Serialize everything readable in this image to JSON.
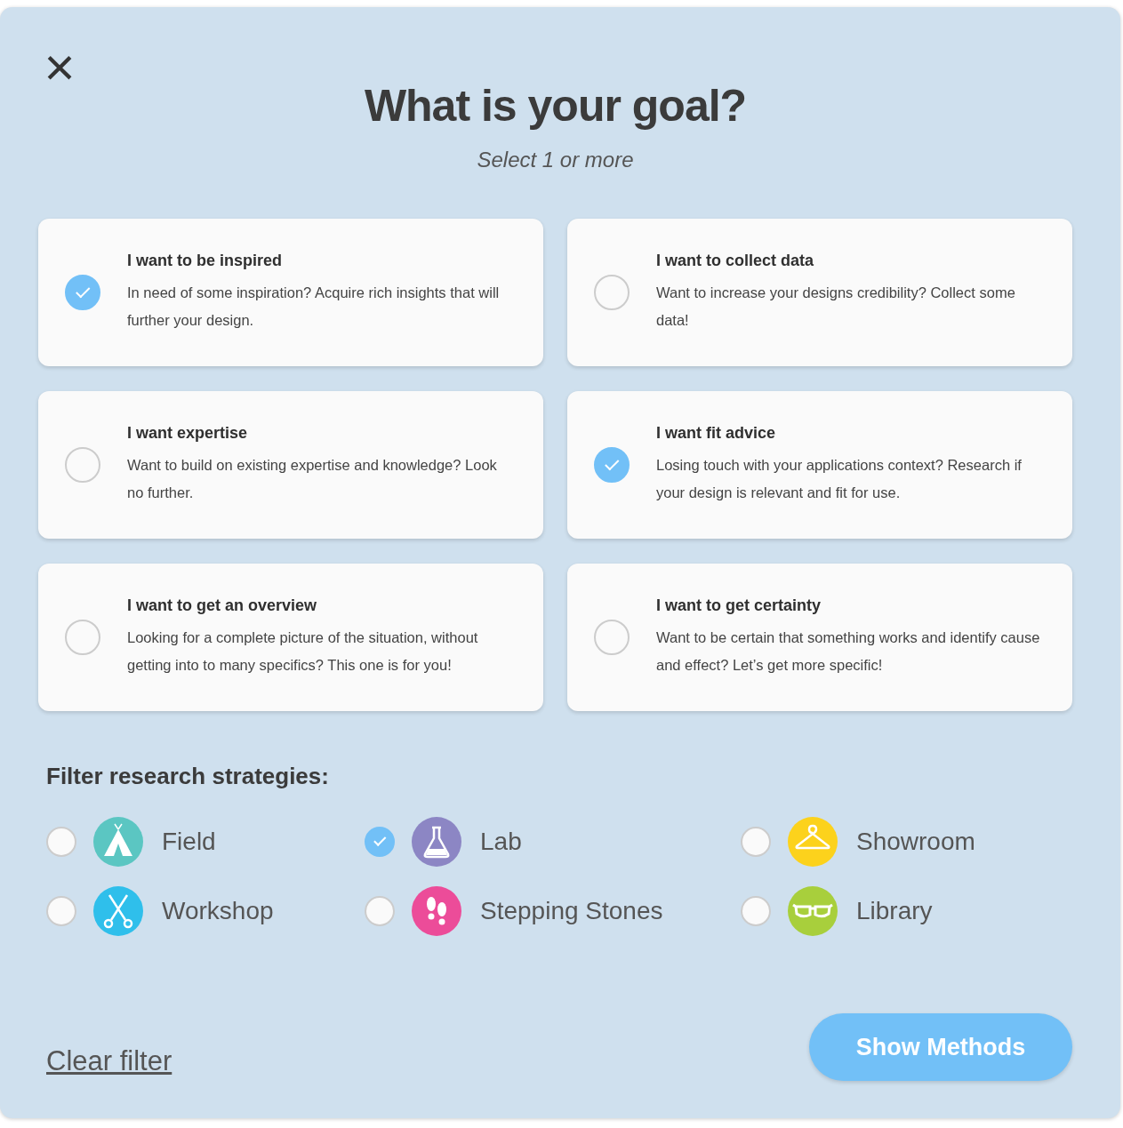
{
  "dialog": {
    "close_icon": "×",
    "title": "What is your goal?",
    "subtitle": "Select 1 or more"
  },
  "goals": [
    {
      "title": "I want to be inspired",
      "description": "In need of some inspiration? Acquire rich insights that will further your design.",
      "selected": true
    },
    {
      "title": "I want to collect data",
      "description": "Want to increase your designs credibility? Collect some data!",
      "selected": false
    },
    {
      "title": "I want expertise",
      "description": "Want to build on existing expertise and knowledge? Look no further.",
      "selected": false
    },
    {
      "title": "I want fit advice",
      "description": "Losing touch with your applications context? Research if your design is relevant and fit for use.",
      "selected": true
    },
    {
      "title": "I want to get an overview",
      "description": "Looking for a complete picture of the situation, without getting into to many specifics? This one is for you!",
      "selected": false
    },
    {
      "title": "I want to get certainty",
      "description": "Want to be certain that something works and identify cause and effect? Let’s get more specific!",
      "selected": false
    }
  ],
  "filter": {
    "heading": "Filter research strategies:",
    "strategies": [
      {
        "label": "Field",
        "kind": "tent",
        "color": "#5bc6c2",
        "selected": false
      },
      {
        "label": "Lab",
        "kind": "flask",
        "color": "#8c86c4",
        "selected": true
      },
      {
        "label": "Showroom",
        "kind": "hanger",
        "color": "#fcd21c",
        "selected": false
      },
      {
        "label": "Workshop",
        "kind": "scissors",
        "color": "#2fbfeb",
        "selected": false
      },
      {
        "label": "Stepping Stones",
        "kind": "footprints",
        "color": "#ec4c99",
        "selected": false
      },
      {
        "label": "Library",
        "kind": "glasses",
        "color": "#a8cf3c",
        "selected": false
      }
    ]
  },
  "footer": {
    "clear_link": "Clear filter",
    "show_button": "Show Methods"
  }
}
